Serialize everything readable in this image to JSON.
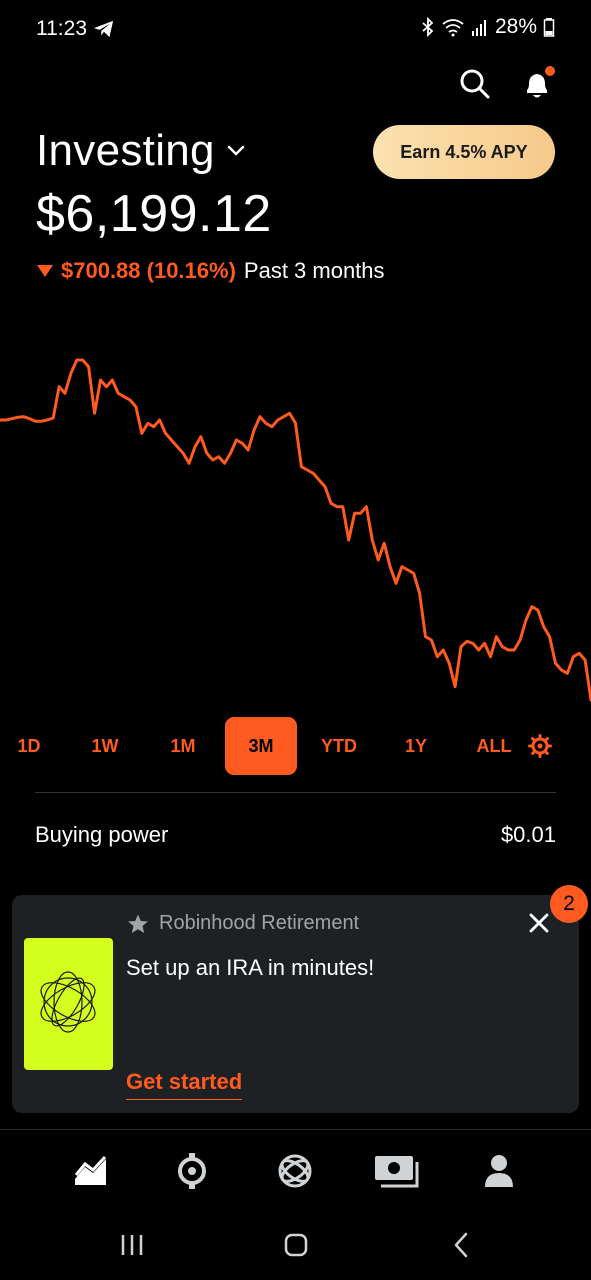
{
  "status_bar": {
    "time": "11:23",
    "battery": "28%",
    "icons": [
      "telegram-icon",
      "bluetooth-icon",
      "wifi-icon",
      "signal-icon",
      "battery-icon"
    ]
  },
  "header": {
    "account_title": "Investing",
    "earn_button": "Earn 4.5% APY",
    "icons": [
      "search-icon",
      "bell-icon"
    ]
  },
  "portfolio": {
    "value": "$6,199.12",
    "change_amount": "$700.88 (10.16%)",
    "change_period": "Past 3 months"
  },
  "chart_data": {
    "type": "line",
    "series": [
      {
        "values": [
          6900,
          6900,
          6902,
          6904,
          6905,
          6902,
          6898,
          6898,
          6900,
          6903,
          6950,
          6940,
          6970,
          6990,
          6990,
          6980,
          6910,
          6960,
          6950,
          6960,
          6940,
          6935,
          6930,
          6920,
          6880,
          6895,
          6890,
          6900,
          6880,
          6870,
          6860,
          6850,
          6835,
          6860,
          6875,
          6850,
          6840,
          6845,
          6835,
          6850,
          6870,
          6865,
          6855,
          6885,
          6905,
          6895,
          6890,
          6900,
          6905,
          6910,
          6895,
          6830,
          6825,
          6820,
          6810,
          6800,
          6775,
          6770,
          6770,
          6720,
          6760,
          6760,
          6770,
          6720,
          6690,
          6715,
          6680,
          6655,
          6680,
          6675,
          6670,
          6640,
          6575,
          6570,
          6545,
          6555,
          6535,
          6500,
          6560,
          6568,
          6565,
          6555,
          6565,
          6545,
          6575,
          6560,
          6555,
          6555,
          6570,
          6600,
          6620,
          6615,
          6590,
          6575,
          6535,
          6525,
          6520,
          6545,
          6550,
          6540,
          6480
        ]
      }
    ],
    "color": "#ff5a1f"
  },
  "range_tabs": {
    "items": [
      "1D",
      "1W",
      "1M",
      "3M",
      "YTD",
      "1Y",
      "ALL"
    ],
    "active": "3M"
  },
  "buying_power": {
    "label": "Buying power",
    "value": "$0.01"
  },
  "promo_card": {
    "kicker": "Robinhood Retirement",
    "title": "Set up an IRA in minutes!",
    "cta": "Get started",
    "badge_count": "2"
  },
  "bottom_nav": {
    "items": [
      "investing-chart-icon",
      "crypto-icon",
      "retirement-icon",
      "cash-icon",
      "account-icon"
    ]
  },
  "colors": {
    "accent": "#ff5a1f",
    "background": "#000000",
    "card": "#1e2124",
    "promo_art": "#d4ff1e",
    "earn_gradient_start": "#fbe2b0",
    "earn_gradient_end": "#f7c98a"
  }
}
